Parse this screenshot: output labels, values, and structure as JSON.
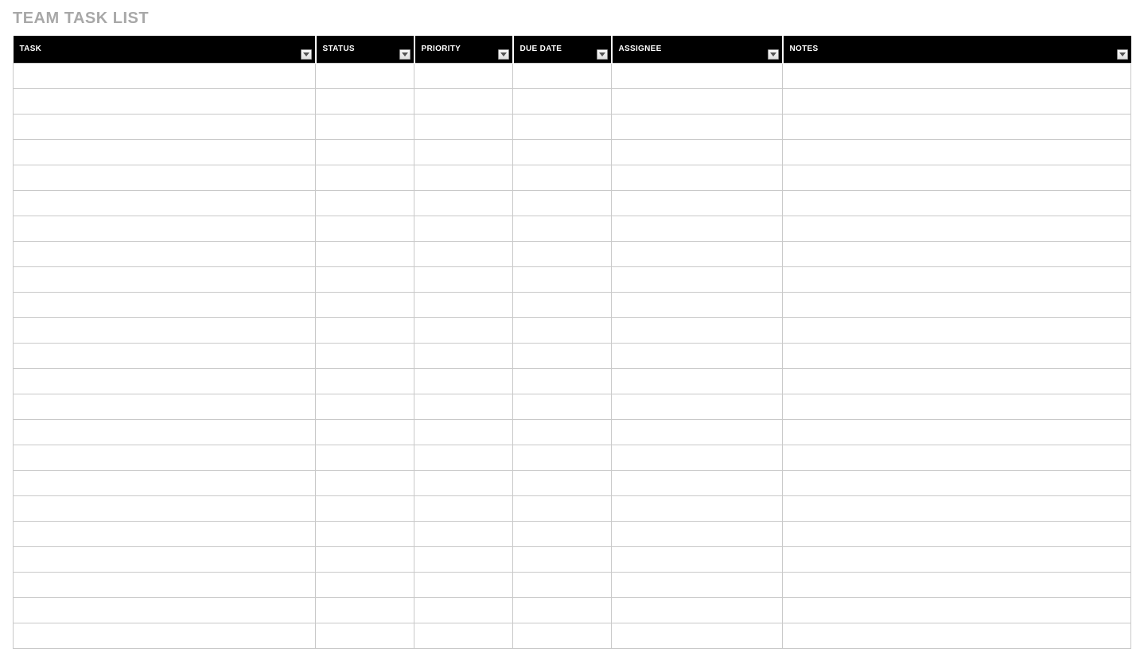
{
  "title": "TEAM TASK LIST",
  "table": {
    "columns": [
      {
        "label": "TASK"
      },
      {
        "label": "STATUS"
      },
      {
        "label": "PRIORITY"
      },
      {
        "label": "DUE DATE"
      },
      {
        "label": "ASSIGNEE"
      },
      {
        "label": "NOTES"
      }
    ],
    "row_count": 23,
    "rows": [
      [
        "",
        "",
        "",
        "",
        "",
        ""
      ],
      [
        "",
        "",
        "",
        "",
        "",
        ""
      ],
      [
        "",
        "",
        "",
        "",
        "",
        ""
      ],
      [
        "",
        "",
        "",
        "",
        "",
        ""
      ],
      [
        "",
        "",
        "",
        "",
        "",
        ""
      ],
      [
        "",
        "",
        "",
        "",
        "",
        ""
      ],
      [
        "",
        "",
        "",
        "",
        "",
        ""
      ],
      [
        "",
        "",
        "",
        "",
        "",
        ""
      ],
      [
        "",
        "",
        "",
        "",
        "",
        ""
      ],
      [
        "",
        "",
        "",
        "",
        "",
        ""
      ],
      [
        "",
        "",
        "",
        "",
        "",
        ""
      ],
      [
        "",
        "",
        "",
        "",
        "",
        ""
      ],
      [
        "",
        "",
        "",
        "",
        "",
        ""
      ],
      [
        "",
        "",
        "",
        "",
        "",
        ""
      ],
      [
        "",
        "",
        "",
        "",
        "",
        ""
      ],
      [
        "",
        "",
        "",
        "",
        "",
        ""
      ],
      [
        "",
        "",
        "",
        "",
        "",
        ""
      ],
      [
        "",
        "",
        "",
        "",
        "",
        ""
      ],
      [
        "",
        "",
        "",
        "",
        "",
        ""
      ],
      [
        "",
        "",
        "",
        "",
        "",
        ""
      ],
      [
        "",
        "",
        "",
        "",
        "",
        ""
      ],
      [
        "",
        "",
        "",
        "",
        "",
        ""
      ],
      [
        "",
        "",
        "",
        "",
        "",
        ""
      ]
    ]
  }
}
